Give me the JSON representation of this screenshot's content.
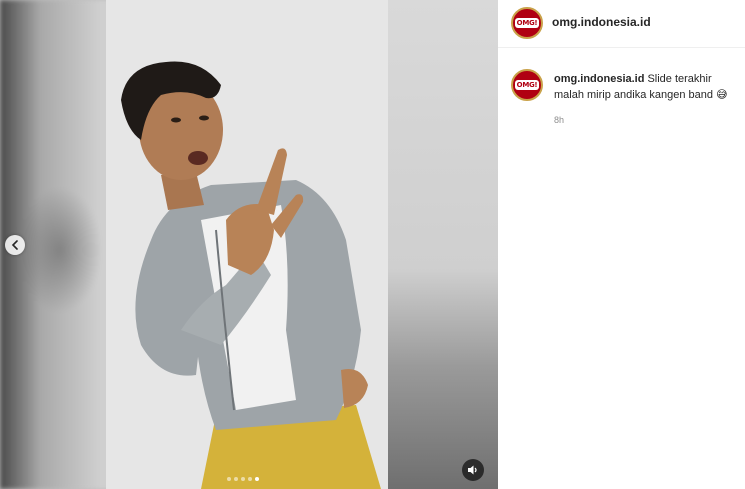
{
  "post": {
    "author": "omg.indonesia.id",
    "avatar_text": "OMG!",
    "caption": {
      "user": "omg.indonesia.id",
      "text": "Slide terakhir malah mirip andika kangen band",
      "emoji": "😅"
    },
    "time": "8h"
  },
  "carousel": {
    "total_slides": 5,
    "active_slide": 5
  },
  "icons": {
    "prev": "chevron-left-icon",
    "audio": "speaker-muted-icon"
  },
  "colors": {
    "brand_red": "#b00012",
    "text": "#262626",
    "muted_text": "#8e8e8e"
  }
}
